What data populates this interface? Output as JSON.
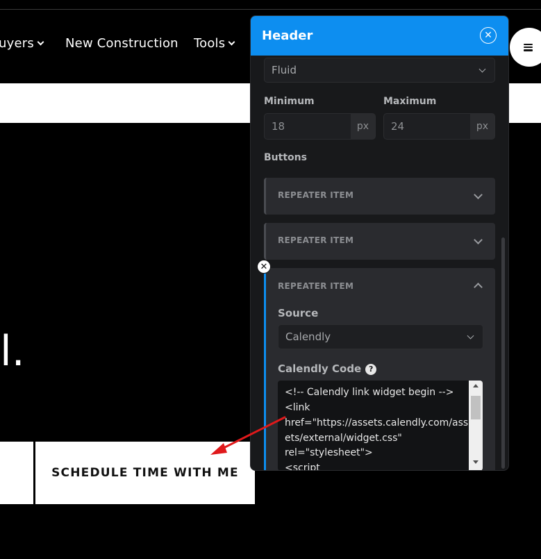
{
  "site": {
    "nav": [
      {
        "label": "uyers",
        "has_dropdown": true
      },
      {
        "label": "New Construction",
        "has_dropdown": false
      },
      {
        "label": "Tools",
        "has_dropdown": true
      }
    ],
    "hero_glyph": "l.",
    "cta_label": "SCHEDULE TIME WITH ME",
    "menu_icon": "hamburger-icon"
  },
  "panel": {
    "title": "Header",
    "close_icon": "close-icon",
    "accent_color": "#0d8ef0",
    "font_size_mode": "Fluid",
    "minimum_label": "Minimum",
    "minimum_value": "18",
    "minimum_unit": "px",
    "maximum_label": "Maximum",
    "maximum_value": "24",
    "maximum_unit": "px",
    "buttons_label": "Buttons",
    "repeater_items": [
      {
        "title": "REPEATER ITEM",
        "expanded": false
      },
      {
        "title": "REPEATER ITEM",
        "expanded": false
      },
      {
        "title": "REPEATER ITEM",
        "expanded": true
      }
    ],
    "source_label": "Source",
    "source_value": "Calendly",
    "code_label": "Calendly Code",
    "code_lines": [
      "<!-- Calendly link widget begin -->",
      "<link",
      "href=\"https://assets.calendly.com/ass",
      "ets/external/widget.css\"",
      "rel=\"stylesheet\">",
      "<script"
    ]
  },
  "annotation": {
    "arrow_color": "#e0191b"
  }
}
